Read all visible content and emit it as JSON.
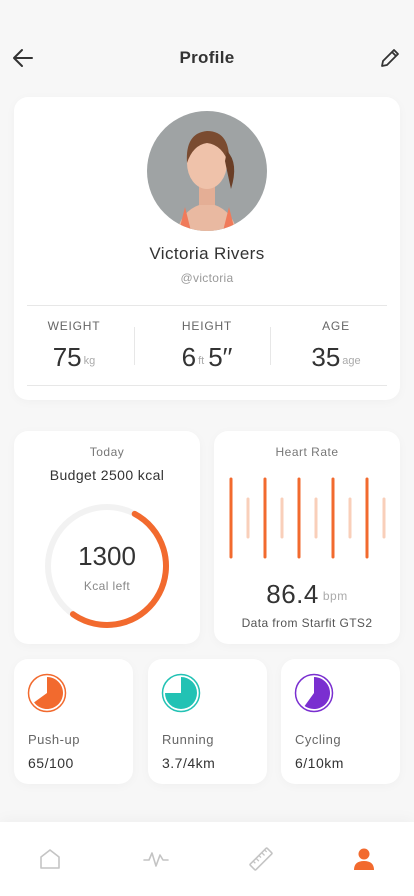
{
  "header": {
    "title": "Profile",
    "back_icon": "arrow-left-icon",
    "edit_icon": "pencil-icon"
  },
  "profile": {
    "name": "Victoria Rivers",
    "handle": "@victoria",
    "stats": {
      "weight": {
        "label": "WEIGHT",
        "value": "75",
        "unit": "kg"
      },
      "height": {
        "label": "HEIGHT",
        "feet": "6",
        "unit": "ft",
        "inches": "5′′"
      },
      "age": {
        "label": "AGE",
        "value": "35",
        "unit": "age"
      }
    }
  },
  "budget": {
    "label": "Today",
    "title": "Budget 2500 kcal",
    "value": "1300",
    "caption": "Kcal left",
    "progress": 0.52
  },
  "heart_rate": {
    "label": "Heart Rate",
    "value": "86.4",
    "unit": "bpm",
    "source": "Data from Starfit GTS2"
  },
  "activities": [
    {
      "name": "Push-up",
      "value": "65/100",
      "progress": 0.65,
      "color": "#f26a2e",
      "icon": "pie-progress-icon"
    },
    {
      "name": "Running",
      "value": "3.7/4km",
      "progress": 0.75,
      "color": "#22c2b4",
      "icon": "pie-progress-icon"
    },
    {
      "name": "Cycling",
      "value": "6/10km",
      "progress": 0.6,
      "color": "#7a2fd0",
      "icon": "pie-progress-icon"
    }
  ],
  "tabbar": {
    "items": [
      {
        "icon": "home-icon",
        "active": false
      },
      {
        "icon": "activity-icon",
        "active": false
      },
      {
        "icon": "ruler-icon",
        "active": false
      },
      {
        "icon": "user-icon",
        "active": true
      }
    ]
  },
  "colors": {
    "accent": "#f26a2e",
    "accent_light": "#f9cfba",
    "ring_track": "#f2f2f2",
    "background": "#f7f7f7"
  }
}
